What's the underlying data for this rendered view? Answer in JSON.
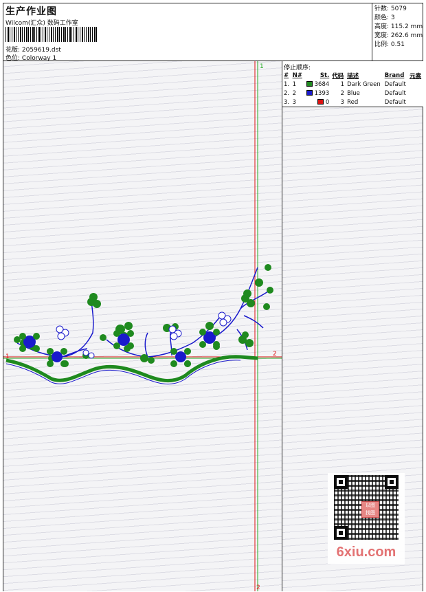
{
  "header": {
    "title": "生产作业图",
    "studio": "Wilcom(汇众) 数码工作室",
    "design_file_label": "花版:",
    "design_file": "2059619.dst",
    "colorway_label": "色位:",
    "colorway": "Colorway 1"
  },
  "stats": {
    "stitches_label": "针数:",
    "stitches": "5079",
    "colors_label": "颜色:",
    "colors": "3",
    "height_label": "高度:",
    "height": "115.2 mm",
    "width_label": "宽度:",
    "width": "262.6 mm",
    "scale_label": "比例:",
    "scale": "0.51"
  },
  "stop_sequence": {
    "title": "停止顺序:",
    "columns": [
      "#",
      "N#",
      "St.",
      "代码",
      "描述",
      "Brand",
      "元素"
    ],
    "rows": [
      {
        "seq": "1.",
        "n": "1",
        "color": "#1f8a1f",
        "stitches": "3684",
        "code": "1",
        "desc": "Dark Green",
        "brand": "Default"
      },
      {
        "seq": "2.",
        "n": "2",
        "color": "#1a1acc",
        "stitches": "1393",
        "code": "2",
        "desc": "Blue",
        "brand": "Default"
      },
      {
        "seq": "3.",
        "n": "3",
        "color": "#dd1111",
        "stitches": "0",
        "code": "3",
        "desc": "Red",
        "brand": "Default"
      }
    ]
  },
  "canvas": {
    "markers": {
      "top": "1",
      "right": "2",
      "bottom": "2",
      "left": "1"
    },
    "colors": {
      "green": "#1f8a1f",
      "blue": "#1a1acc",
      "red": "#dd1111",
      "guide": "#22aa22"
    }
  },
  "watermark": {
    "seal_text": [
      "以图",
      "找图"
    ],
    "site": "6xiu.com"
  }
}
